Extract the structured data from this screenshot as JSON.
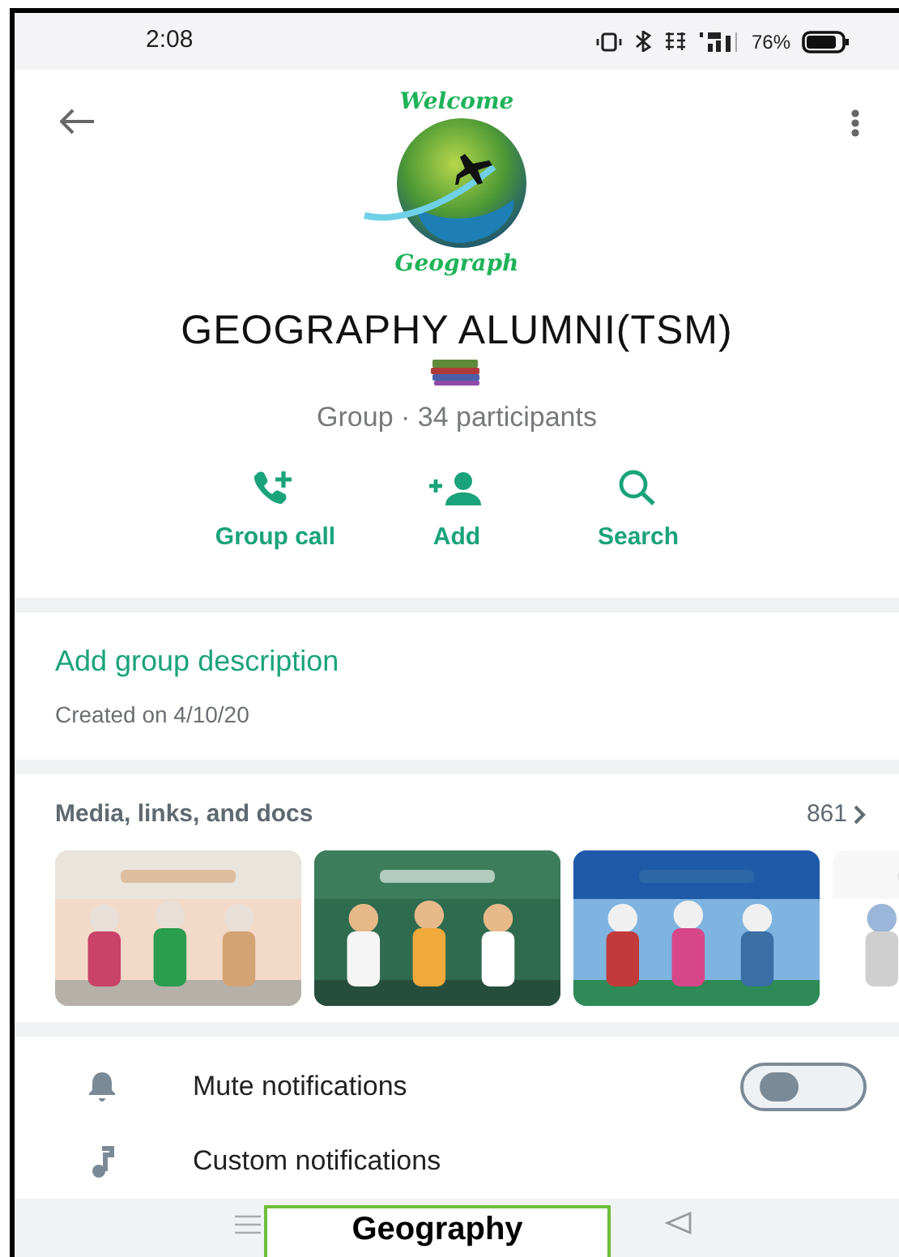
{
  "status_bar": {
    "time": "2:08",
    "battery": "76%"
  },
  "avatar": {
    "top_text": "Welcome",
    "bottom_text": "Geograph"
  },
  "group": {
    "name": "GEOGRAPHY ALUMNI(TSM)",
    "subtitle": "Group · 34 participants"
  },
  "actions": [
    {
      "kind": "call",
      "label": "Group call"
    },
    {
      "kind": "add",
      "label": "Add"
    },
    {
      "kind": "search",
      "label": "Search"
    }
  ],
  "description": {
    "link": "Add group description",
    "created": "Created on 4/10/20"
  },
  "media": {
    "title": "Media, links, and docs",
    "count": "861"
  },
  "settings": [
    {
      "kind": "toggle",
      "label": "Mute notifications",
      "on": false
    },
    {
      "kind": "plain",
      "label": "Custom notifications"
    }
  ],
  "caption": "Geography"
}
